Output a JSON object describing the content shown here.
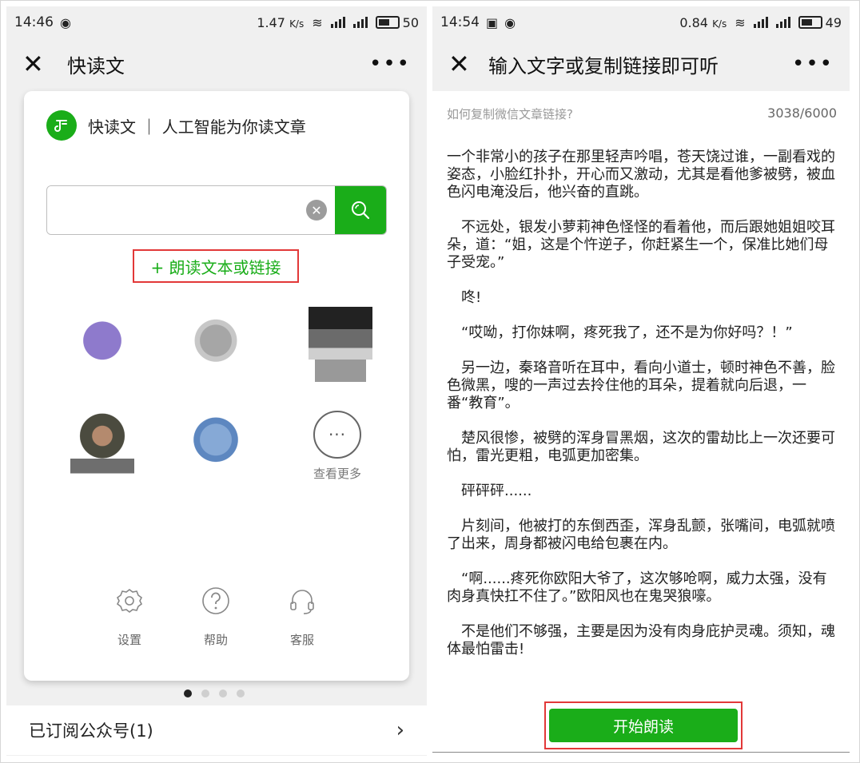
{
  "left": {
    "status": {
      "time": "14:46",
      "speed": "1.47",
      "speed_unit": "K/s",
      "network": "4G",
      "battery": "50"
    },
    "nav": {
      "close": "✕",
      "title": "快读文",
      "more": "•••"
    },
    "card": {
      "brand": "快读文 ｜ 人工智能为你读文章",
      "search_placeholder": "",
      "read_link": "+ 朗读文本或链接",
      "more_label": "查看更多",
      "tools": [
        {
          "label": "设置",
          "icon": "gear-icon"
        },
        {
          "label": "帮助",
          "icon": "help-icon"
        },
        {
          "label": "客服",
          "icon": "headset-icon"
        }
      ]
    },
    "pager": {
      "total": 4,
      "active": 1
    },
    "subscribed": {
      "label": "已订阅公众号(1)",
      "chevron": "›"
    }
  },
  "right": {
    "status": {
      "time": "14:54",
      "speed": "0.84",
      "speed_unit": "K/s",
      "network": "4G",
      "battery": "49"
    },
    "nav": {
      "close": "✕",
      "title": "输入文字或复制链接即可听",
      "more": "•••"
    },
    "hint": "如何复制微信文章链接?",
    "count": "3038/6000",
    "paragraphs": [
      "一个非常小的孩子在那里轻声吟唱，苍天饶过谁，一副看戏的姿态，小脸红扑扑，开心而又激动，尤其是看他爹被劈，被血色闪电淹没后，他兴奋的直跳。",
      "　不远处，银发小萝莉神色怪怪的看着他，而后跟她姐姐咬耳朵，道：“姐，这是个忤逆子，你赶紧生一个，保准比她们母子受宠。”",
      "　咚!",
      "　“哎呦，打你妹啊，疼死我了，还不是为你好吗？！”",
      "　另一边，秦珞音听在耳中，看向小道士，顿时神色不善，脸色微黑，嗖的一声过去拎住他的耳朵，提着就向后退，一番“教育”。",
      "　楚风很惨，被劈的浑身冒黑烟，这次的雷劫比上一次还要可怕，雷光更粗，电弧更加密集。",
      "　砰砰砰......",
      "　片刻间，他被打的东倒西歪，浑身乱颤，张嘴间，电弧就喷了出来，周身都被闪电给包裹在内。",
      "　“啊......疼死你欧阳大爷了，这次够呛啊，威力太强，没有肉身真快扛不住了。”欧阳风也在鬼哭狼嚎。",
      "　不是他们不够强，主要是因为没有肉身庇护灵魂。须知，魂体最怕雷击!"
    ],
    "start_button": "开始朗读"
  },
  "colors": {
    "accent": "#1aad19",
    "highlight": "#e23838",
    "background": "#f0f0f0"
  }
}
